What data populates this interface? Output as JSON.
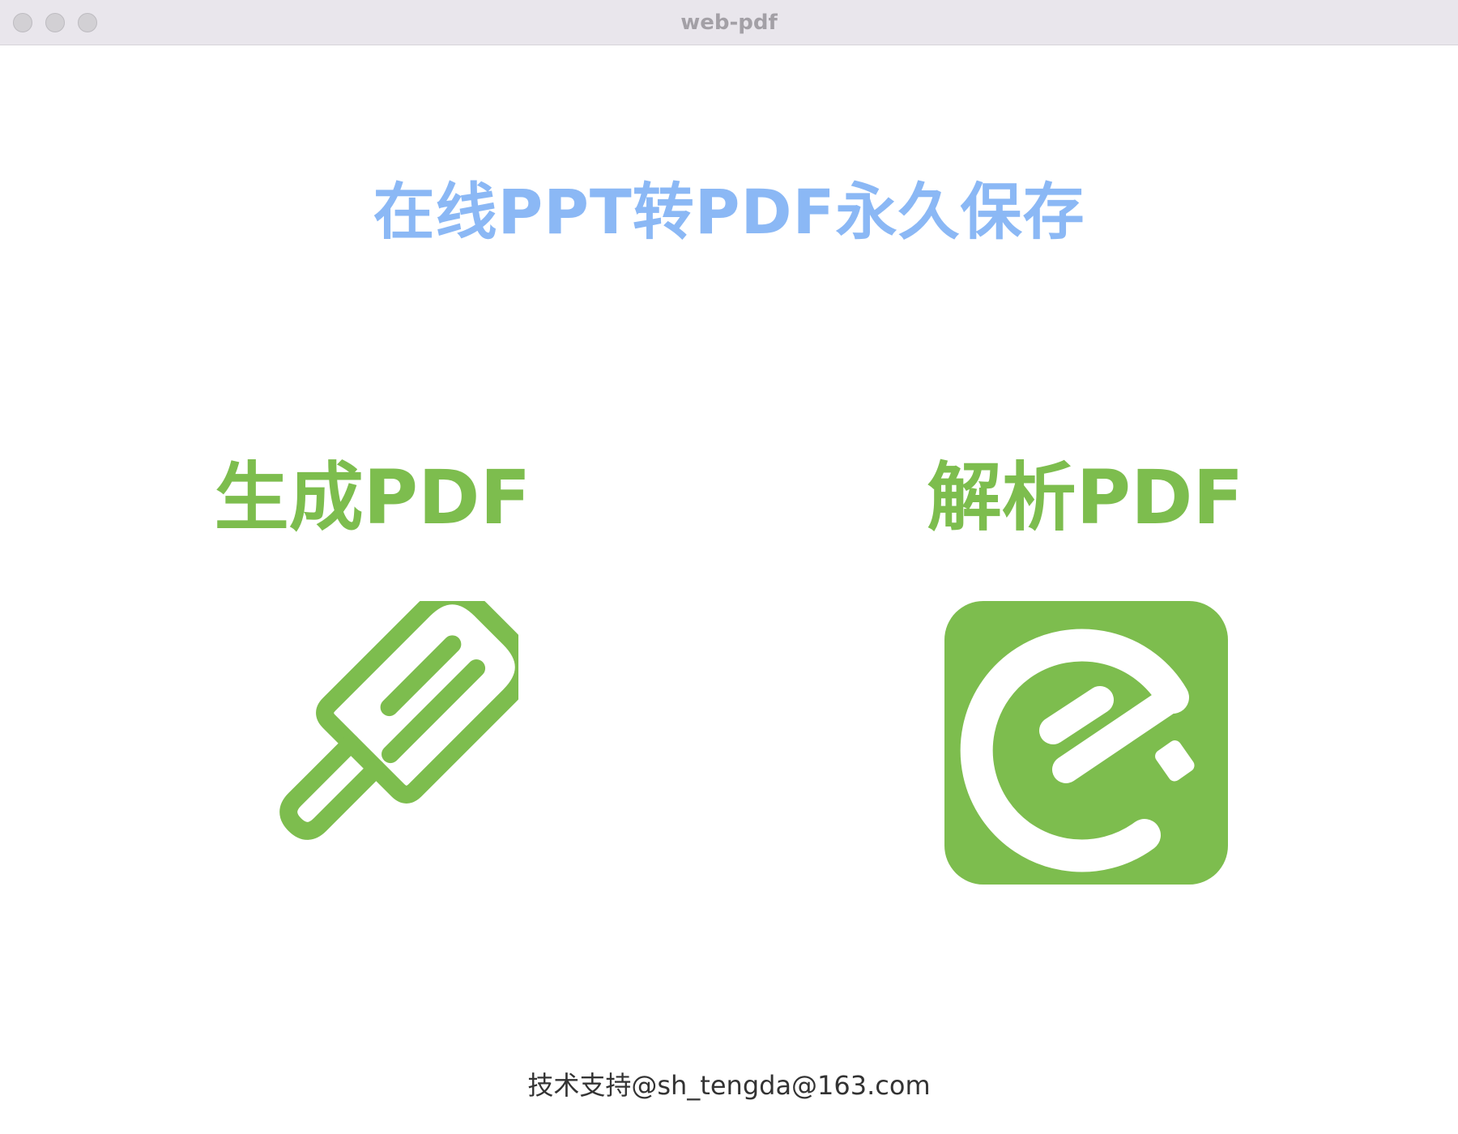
{
  "window": {
    "title": "web-pdf"
  },
  "main": {
    "headline": "在线PPT转PDF永久保存",
    "cards": [
      {
        "label": "生成PDF",
        "icon": "popsicle-icon"
      },
      {
        "label": "解析PDF",
        "icon": "evernote-e-icon"
      }
    ]
  },
  "footer": {
    "text": "技术支持@sh_tengda@163.com"
  },
  "colors": {
    "headline": "#8bb8f5",
    "accent_green": "#7dbd4e",
    "titlebar": "#e9e6ec"
  }
}
